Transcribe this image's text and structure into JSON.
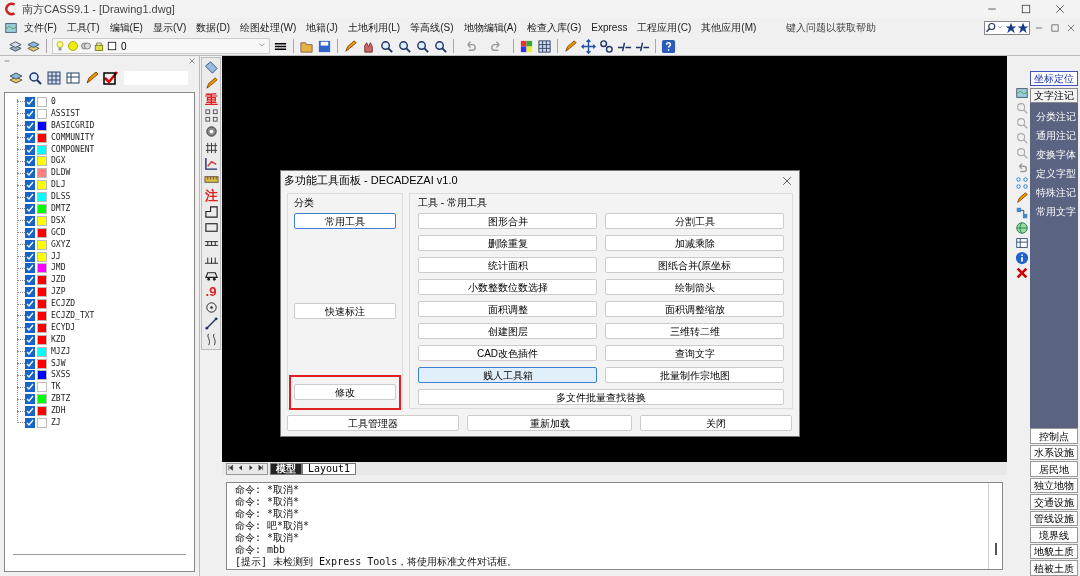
{
  "window": {
    "title": "南方CASS9.1 - [Drawing1.dwg]"
  },
  "menu": [
    "文件(F)",
    "工具(T)",
    "编辑(E)",
    "显示(V)",
    "数据(D)",
    "绘图处理(W)",
    "地籍(J)",
    "土地利用(L)",
    "等高线(S)",
    "地物编辑(A)",
    "检查入库(G)",
    "Express",
    "工程应用(C)",
    "其他应用(M)"
  ],
  "help_search": {
    "placeholder": "键入问题以获取帮助"
  },
  "layer_toolbar": {
    "current_layer": "0"
  },
  "layer_panel": {
    "layers": [
      {
        "name": "0",
        "visible": true,
        "color": "#ffffff"
      },
      {
        "name": "ASSIST",
        "visible": true,
        "color": "#ffffff"
      },
      {
        "name": "BASICGRID",
        "visible": true,
        "color": "#0000ff"
      },
      {
        "name": "COMMUNITY",
        "visible": true,
        "color": "#ff0000"
      },
      {
        "name": "COMPONENT",
        "visible": true,
        "color": "#00ffff"
      },
      {
        "name": "DGX",
        "visible": true,
        "color": "#ffff00"
      },
      {
        "name": "DLDW",
        "visible": true,
        "color": "#ff8080"
      },
      {
        "name": "DLJ",
        "visible": true,
        "color": "#ffff00"
      },
      {
        "name": "DLSS",
        "visible": true,
        "color": "#00ffff"
      },
      {
        "name": "DMTZ",
        "visible": true,
        "color": "#00ff00"
      },
      {
        "name": "DSX",
        "visible": true,
        "color": "#ffff00"
      },
      {
        "name": "GCD",
        "visible": true,
        "color": "#ff0000"
      },
      {
        "name": "GXYZ",
        "visible": true,
        "color": "#ffff00"
      },
      {
        "name": "JJ",
        "visible": true,
        "color": "#ffff00"
      },
      {
        "name": "JMD",
        "visible": true,
        "color": "#ff00ff"
      },
      {
        "name": "JZD",
        "visible": true,
        "color": "#ff0000"
      },
      {
        "name": "JZP",
        "visible": true,
        "color": "#ff0000"
      },
      {
        "name": "ECJZD",
        "visible": true,
        "color": "#ff0000"
      },
      {
        "name": "ECJZD_TXT",
        "visible": true,
        "color": "#ff0000"
      },
      {
        "name": "ECYDJ",
        "visible": true,
        "color": "#ff0000"
      },
      {
        "name": "KZD",
        "visible": true,
        "color": "#ff0000"
      },
      {
        "name": "MJZJ",
        "visible": true,
        "color": "#00ffff"
      },
      {
        "name": "SJW",
        "visible": true,
        "color": "#ff0000"
      },
      {
        "name": "SXSS",
        "visible": true,
        "color": "#0000ff"
      },
      {
        "name": "TK",
        "visible": true,
        "color": "#ffffff"
      },
      {
        "name": "ZBTZ",
        "visible": true,
        "color": "#00ff00"
      },
      {
        "name": "ZDH",
        "visible": true,
        "color": "#ff0000"
      },
      {
        "name": "ZJ",
        "visible": true,
        "color": "#ffffff"
      }
    ]
  },
  "vertical_toolbar": [
    {
      "kind": "icon"
    },
    {
      "kind": "icon"
    },
    {
      "kind": "glyph",
      "text": "重"
    },
    {
      "kind": "icon"
    },
    {
      "kind": "icon"
    },
    {
      "kind": "icon"
    },
    {
      "kind": "icon"
    },
    {
      "kind": "icon"
    },
    {
      "kind": "glyph",
      "text": "注"
    },
    {
      "kind": "icon"
    },
    {
      "kind": "icon"
    },
    {
      "kind": "icon"
    },
    {
      "kind": "icon"
    },
    {
      "kind": "icon"
    },
    {
      "kind": "glyph",
      "text": ".9"
    },
    {
      "kind": "icon"
    },
    {
      "kind": "icon"
    },
    {
      "kind": "icon"
    }
  ],
  "dialog": {
    "title": "多功能工具面板 - DECADEZAI v1.0",
    "categories_label": "分类",
    "categories": [
      {
        "label": "常用工具",
        "selected": true,
        "annotated": false
      },
      {
        "label": "快速标注",
        "selected": false,
        "annotated": false
      },
      {
        "label": "修改",
        "selected": false,
        "annotated": true
      }
    ],
    "tools_label": "工具 - 常用工具",
    "tools": [
      {
        "label": "图形合并",
        "selected": false
      },
      {
        "label": "分割工具",
        "selected": false
      },
      {
        "label": "删除重复",
        "selected": false
      },
      {
        "label": "加减乘除",
        "selected": false
      },
      {
        "label": "统计面积",
        "selected": false
      },
      {
        "label": "图纸合并(原坐标",
        "selected": false
      },
      {
        "label": "小数整数位数选择",
        "selected": false
      },
      {
        "label": "绘制箭头",
        "selected": false
      },
      {
        "label": "面积调整",
        "selected": false
      },
      {
        "label": "面积调整缩放",
        "selected": false
      },
      {
        "label": "创建图层",
        "selected": false
      },
      {
        "label": "三维转二维",
        "selected": false
      },
      {
        "label": "CAD改色插件",
        "selected": false
      },
      {
        "label": "查询文字",
        "selected": false
      },
      {
        "label": "贱人工具箱",
        "selected": true
      },
      {
        "label": "批量制作宗地图",
        "selected": false
      }
    ],
    "wide_tool": "多文件批量查找替换",
    "footer_buttons": [
      "工具管理器",
      "重新加载",
      "关闭"
    ]
  },
  "layout_tabs": [
    {
      "label": "模型",
      "selected": true
    },
    {
      "label": "Layout1",
      "selected": false
    }
  ],
  "command_lines": [
    "命令: *取消*",
    "命令: *取消*",
    "命令: *取消*",
    "命令: 吧*取消*",
    "命令: *取消*",
    "命令: mbb",
    "[提示] 未检测到 Express Tools，将使用标准文件对话框。"
  ],
  "right_panel": {
    "top_tabs": [
      {
        "label": "坐标定位",
        "selected": false
      },
      {
        "label": "文字注记",
        "selected": true
      }
    ],
    "items": [
      "分类注记",
      "通用注记",
      "变换字体",
      "定义字型",
      "特殊注记",
      "常用文字"
    ],
    "bottom_tabs": [
      "控制点",
      "水系设施",
      "居民地",
      "独立地物",
      "交通设施",
      "管线设施",
      "境界线",
      "地貌土质",
      "植被土质"
    ]
  }
}
